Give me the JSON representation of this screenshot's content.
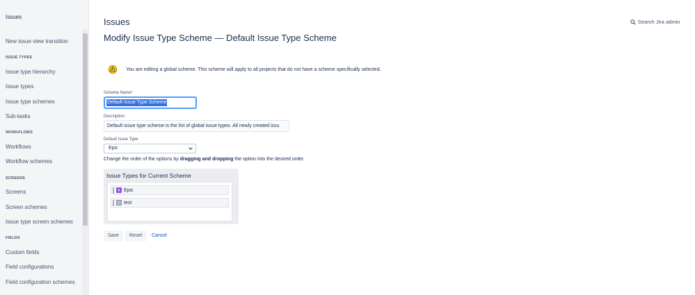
{
  "sidebar": {
    "title": "Issues",
    "items": [
      {
        "type": "item",
        "label": "New issue view transition"
      },
      {
        "type": "section",
        "label": "ISSUE TYPES"
      },
      {
        "type": "item",
        "label": "Issue type hierarchy"
      },
      {
        "type": "item",
        "label": "Issue types"
      },
      {
        "type": "item",
        "label": "Issue type schemes"
      },
      {
        "type": "item",
        "label": "Sub-tasks"
      },
      {
        "type": "section",
        "label": "WORKFLOWS"
      },
      {
        "type": "item",
        "label": "Workflows"
      },
      {
        "type": "item",
        "label": "Workflow schemes"
      },
      {
        "type": "section",
        "label": "SCREENS"
      },
      {
        "type": "item",
        "label": "Screens"
      },
      {
        "type": "item",
        "label": "Screen schemes"
      },
      {
        "type": "item",
        "label": "Issue type screen schemes"
      },
      {
        "type": "section",
        "label": "FIELDS"
      },
      {
        "type": "item",
        "label": "Custom fields"
      },
      {
        "type": "item",
        "label": "Field configurations"
      },
      {
        "type": "item",
        "label": "Field configuration schemes"
      }
    ]
  },
  "header": {
    "title": "Issues",
    "search_label": "Search Jira admin"
  },
  "main": {
    "heading": "Modify Issue Type Scheme — Default Issue Type Scheme",
    "warning": "You are editing a global scheme. This scheme will apply to all projects that do not have a scheme specifically selected.",
    "scheme_name_label": "Scheme Name",
    "required_mark": "*",
    "scheme_name_value": "Default Issue Type Scheme",
    "description_label": "Description",
    "description_value": "Default issue type scheme is the list of global issue types. All newly created issu",
    "default_type_label": "Default Issue Type",
    "default_type_value": "Epic",
    "order_hint_pre": "Change the order of the options by ",
    "order_hint_bold": "dragging and dropping",
    "order_hint_post": " the option into the desired order.",
    "panel_title": "Issue Types for Current Scheme",
    "issue_types": [
      {
        "label": "Epic",
        "icon": "epic-icon",
        "color": "#904ee2"
      },
      {
        "label": "test",
        "icon": "issue-type-icon",
        "color": "#8993a4"
      }
    ],
    "save_label": "Save",
    "reset_label": "Reset",
    "cancel_label": "Cancel"
  }
}
